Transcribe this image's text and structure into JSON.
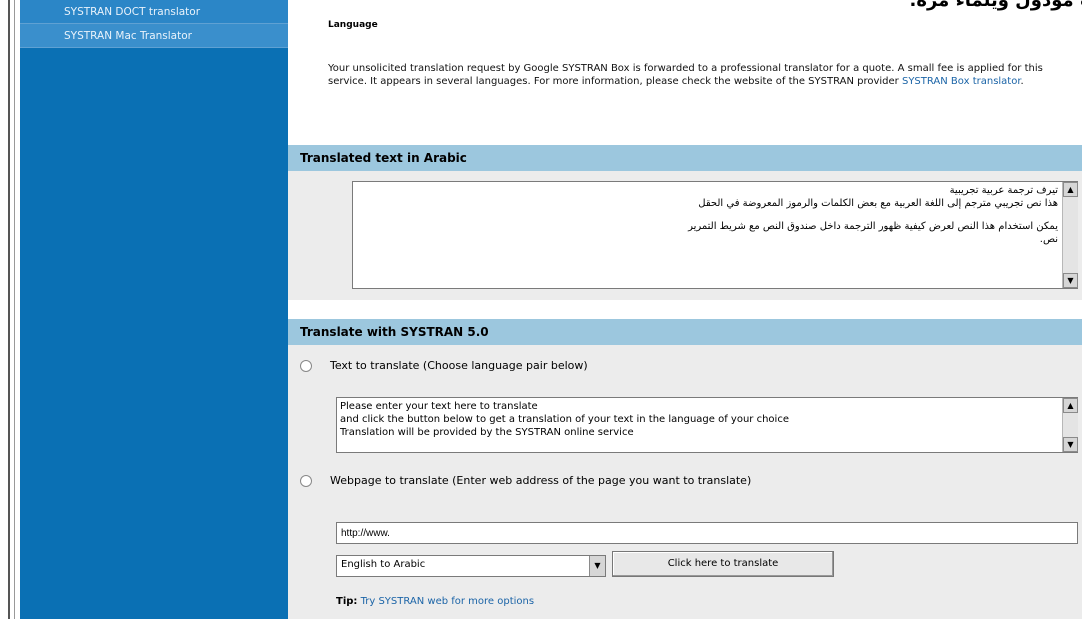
{
  "sidebar": {
    "items": [
      {
        "label": "SYSTRAN DOCT translator"
      },
      {
        "label": "SYSTRAN Mac Translator"
      }
    ]
  },
  "main": {
    "top_heading_arabic": "ت مودول ويلماء مرة.",
    "language_label": "Language",
    "description": "Your unsolicited translation request by Google SYSTRAN Box is forwarded to a professional translator for a quote. A small fee is applied for this service. It appears in several languages. For more information, please check the website of the SYSTRAN provider",
    "description_link": "SYSTRAN Box translator",
    "translated_header": "Translated text in Arabic",
    "translated_text_line1": "تيرف ترجمة عربية تجريبية",
    "translated_text_line2": "هذا نص تجريبي مترجم إلى اللغة العربية مع بعض الكلمات والرموز المعروضة في الحقل",
    "translated_text_line3": "يمكن استخدام هذا النص لعرض كيفية ظهور الترجمة داخل صندوق النص مع شريط التمرير",
    "translated_text_line4": "نص.",
    "translate_header": "Translate with SYSTRAN 5.0",
    "option_text_label": "Text to translate (Choose language pair below)",
    "source_text_line1": "Please enter your text here to translate",
    "source_text_line2": "and click the button below to get a translation of your text in the language of your choice",
    "source_text_line3": "Translation will be provided by the SYSTRAN online service",
    "option_web_label": "Webpage to translate (Enter web address of the page you want to translate)",
    "url_value": "http://www.",
    "language_pair": "English to Arabic",
    "translate_button": "Click here to translate",
    "tip_label": "Tip:",
    "tip_link": "Try SYSTRAN web for more options"
  }
}
